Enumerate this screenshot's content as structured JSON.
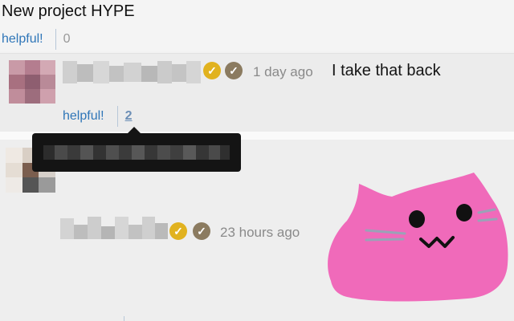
{
  "post": {
    "title": "New project HYPE",
    "helpful_label": "helpful!",
    "helpful_count": "0"
  },
  "comments": [
    {
      "time": "1 day ago",
      "text": "I take that back",
      "helpful_label": "helpful!",
      "helpful_count": "2",
      "badges": [
        "check-gold-badge",
        "check-brown-badge"
      ]
    },
    {
      "time": "23 hours ago",
      "text": "",
      "sticker": "pink-cat-blob-emoji",
      "badges": [
        "check-gold-badge",
        "check-brown-badge"
      ]
    }
  ],
  "colors": {
    "link_blue": "#2f76b8",
    "badge_gold": "#e1b21f",
    "badge_brown": "#8b7b60",
    "sticker_pink": "#f06aba",
    "tooltip_bg": "#141414"
  }
}
